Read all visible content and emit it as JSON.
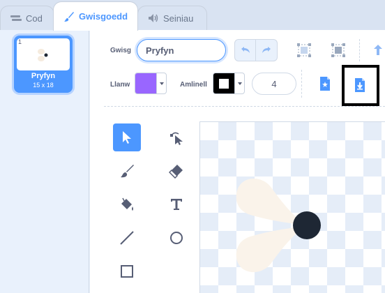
{
  "tabs": [
    {
      "label": "Cod",
      "icon": "code-icon"
    },
    {
      "label": "Gwisgoedd",
      "icon": "brush-icon"
    },
    {
      "label": "Seiniau",
      "icon": "speaker-icon"
    }
  ],
  "costumes": [
    {
      "number": "1",
      "name": "Pryfyn",
      "size": "15 x 18"
    }
  ],
  "editor": {
    "costume_label": "Gwisg",
    "costume_name": "Pryfyn",
    "fill_label": "Llanw",
    "fill_color": "#9966ff",
    "outline_label": "Amlinell",
    "outline_color": "#000000",
    "outline_width": "4"
  },
  "colors": {
    "accent": "#4c97ff",
    "shape_fill": "#faf3ea",
    "dot": "#1e2734"
  },
  "tools": [
    "select",
    "reshape",
    "brush",
    "eraser",
    "fill",
    "text",
    "line",
    "circle",
    "rectangle"
  ]
}
